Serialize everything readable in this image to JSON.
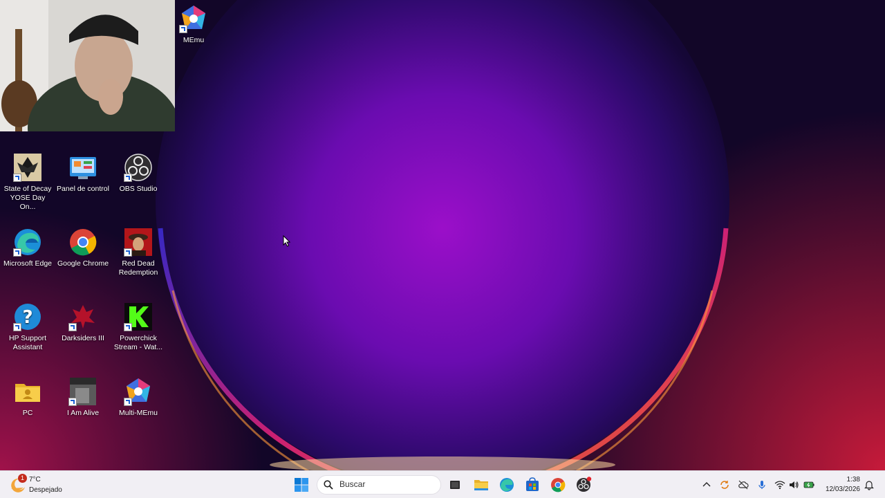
{
  "desktop": {
    "icons": [
      {
        "label": "MEmu",
        "icon": "memu-icon"
      },
      {
        "label": "State of Decay YOSE Day On...",
        "icon": "state-of-decay-icon"
      },
      {
        "label": "Panel de control",
        "icon": "control-panel-icon"
      },
      {
        "label": "OBS Studio",
        "icon": "obs-studio-icon"
      },
      {
        "label": "Microsoft Edge",
        "icon": "edge-icon"
      },
      {
        "label": "Google Chrome",
        "icon": "chrome-icon"
      },
      {
        "label": "Red Dead Redemption",
        "icon": "red-dead-icon"
      },
      {
        "label": "HP Support Assistant",
        "icon": "hp-support-icon"
      },
      {
        "label": "Darksiders III",
        "icon": "darksiders-icon"
      },
      {
        "label": "Powerchick Stream - Wat...",
        "icon": "powerchick-icon"
      },
      {
        "label": "PC",
        "icon": "pc-folder-icon"
      },
      {
        "label": "I Am Alive",
        "icon": "i-am-alive-icon"
      },
      {
        "label": "Multi-MEmu",
        "icon": "multi-memu-icon"
      }
    ]
  },
  "taskbar": {
    "weather": {
      "temp": "7°C",
      "condition": "Despejado",
      "badge": "1"
    },
    "search_placeholder": "Buscar",
    "apps": [
      "task-view-icon",
      "file-explorer-icon",
      "edge-icon",
      "store-icon",
      "chrome-icon",
      "obs-icon"
    ],
    "tray": [
      "chevron-up-icon",
      "sync-icon",
      "cloud-off-icon",
      "microphone-icon",
      "wifi-icon",
      "speaker-icon",
      "battery-icon"
    ],
    "clock": {
      "time": "1:38",
      "date": "12/03/2026"
    }
  },
  "colors": {
    "accent": "#0067c0",
    "taskbar_bg": "#f1eff4"
  }
}
